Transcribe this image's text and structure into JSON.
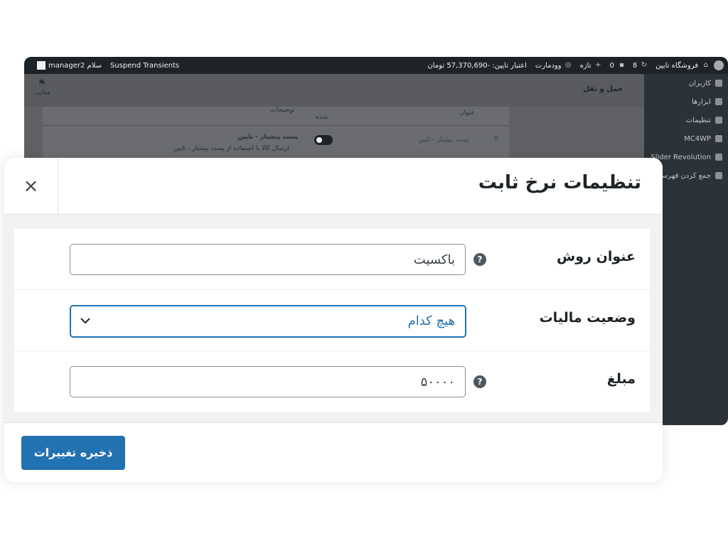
{
  "admin_bar": {
    "site_name": "فروشگاه تایین",
    "updates_count": "8",
    "comments_count": "0",
    "new_label": "تازه",
    "woodmart_label": "وودمارت",
    "credit_text": "اعتبار تایین: -57,370,690 تومان",
    "suspend_transients": "Suspend Transients",
    "greeting": "سلام manager2"
  },
  "side_menu": {
    "items": [
      "کاربران",
      "ابزارها",
      "تنظیمات",
      "MC4WP",
      "Slider Revolution",
      "جمع کردن فهرست"
    ]
  },
  "background_page": {
    "section_title": "حمل و نقل",
    "activity_label": "فعالیت",
    "table_header_title": "عنوان",
    "table_header_description": "توضیحات",
    "table_header_enabled": "شده",
    "row_method_name": "پست پیشتاز - تایین",
    "row_method_title": "پست پیشتاز - تایین",
    "row_method_desc": "ارسال کالا با استفاده از پست پیشتاز - تایین"
  },
  "modal": {
    "title": "تنظیمات نرخ ثابت",
    "close_symbol": "×",
    "fields": {
      "method_title_label": "عنوان روش",
      "method_title_value": "باکسیت",
      "tax_status_label": "وضعیت مالیات",
      "tax_status_value": "هیچ کدام",
      "cost_label": "مبلغ",
      "cost_value": "۵۰۰۰۰"
    },
    "help_symbol": "?",
    "save_button": "ذخیره تغییرات"
  },
  "colors": {
    "accent": "#2271b1",
    "admin_bar": "#1d2327",
    "sidebar": "#2c3338"
  }
}
